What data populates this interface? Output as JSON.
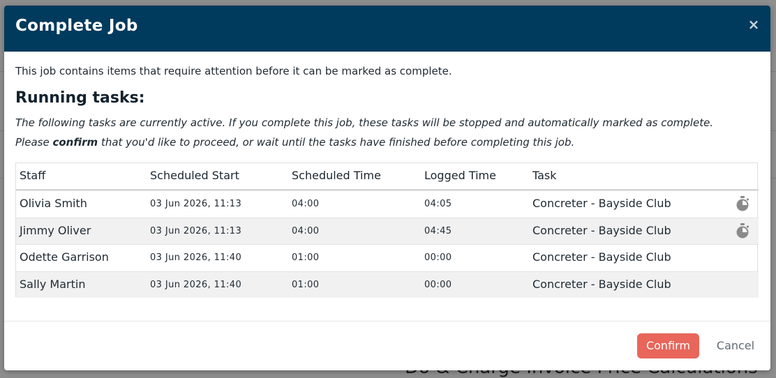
{
  "background": {
    "heading": "Do & Charge Invoice Price Calculations"
  },
  "modal": {
    "title": "Complete Job",
    "close_label": "×",
    "intro": "This job contains items that require attention before it can be marked as complete.",
    "section_title": "Running tasks:",
    "desc_line1": "The following tasks are currently active. If you complete this job, these tasks will be stopped and automatically marked as complete.",
    "desc_line2_pre": "Please ",
    "desc_line2_bold": "confirm",
    "desc_line2_post": " that you'd like to proceed, or wait until the tasks have finished before completing this job."
  },
  "table": {
    "headers": [
      "Staff",
      "Scheduled Start",
      "Scheduled Time",
      "Logged Time",
      "Task"
    ],
    "rows": [
      {
        "staff": "Olivia Smith",
        "start": "03 Jun 2026, 11:13",
        "scheduled": "04:00",
        "logged": "04:05",
        "task": "Concreter - Bayside Club",
        "timer_icon": "stopwatch-icon"
      },
      {
        "staff": "Jimmy Oliver",
        "start": "03 Jun 2026, 11:13",
        "scheduled": "04:00",
        "logged": "04:45",
        "task": "Concreter - Bayside Club",
        "timer_icon": "stopwatch-icon"
      },
      {
        "staff": "Odette Garrison",
        "start": "03 Jun 2026, 11:40",
        "scheduled": "01:00",
        "logged": "00:00",
        "task": "Concreter - Bayside Club"
      },
      {
        "staff": "Sally Martin",
        "start": "03 Jun 2026, 11:40",
        "scheduled": "01:00",
        "logged": "00:00",
        "task": "Concreter - Bayside Club"
      }
    ]
  },
  "footer": {
    "confirm_label": "Confirm",
    "cancel_label": "Cancel"
  },
  "colors": {
    "header_bg": "#003a5d",
    "confirm_bg": "#e8665a",
    "alt_row": "#f1f1f1"
  }
}
